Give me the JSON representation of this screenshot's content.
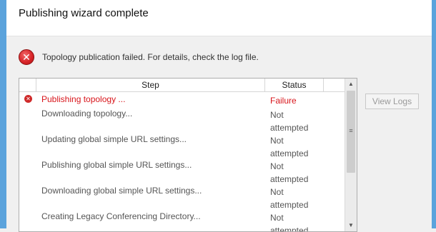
{
  "window": {
    "title": "Publishing wizard complete"
  },
  "status": {
    "message": "Topology publication failed. For details, check the log file.",
    "icon": "error-icon"
  },
  "table": {
    "columns": [
      "",
      "Step",
      "Status",
      ""
    ],
    "rows": [
      {
        "step": "Publishing topology ...",
        "status": "Failure",
        "failed": true
      },
      {
        "step": "Downloading topology...",
        "status": "Not attempted",
        "failed": false
      },
      {
        "step": "Updating global simple URL settings...",
        "status": "Not attempted",
        "failed": false
      },
      {
        "step": "Publishing global simple URL settings...",
        "status": "Not attempted",
        "failed": false
      },
      {
        "step": "Downloading global simple URL settings...",
        "status": "Not attempted",
        "failed": false
      },
      {
        "step": "Creating Legacy Conferencing Directory...",
        "status": "Not attempted",
        "failed": false
      }
    ]
  },
  "buttons": {
    "view_logs": "View Logs"
  },
  "colors": {
    "failure": "#d8151b",
    "frame": "#5ba3dc"
  }
}
